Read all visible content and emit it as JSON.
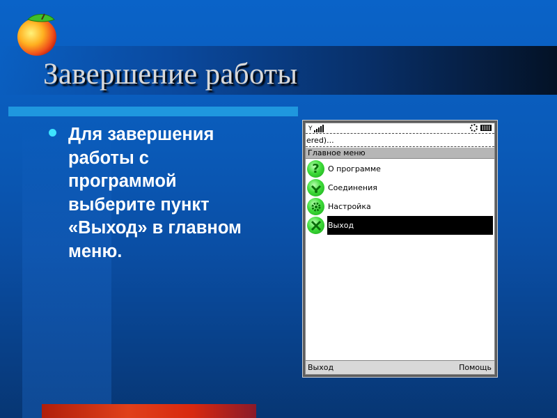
{
  "slide": {
    "title": "Завершение работы",
    "bullet": "Для завершения\nработы с\nпрограммой\nвыберите пункт\n«Выход» в главном\n меню."
  },
  "phone": {
    "connecting_text": "ered)...",
    "menu_header": "Главное меню",
    "menu_items": [
      {
        "label": "О программе",
        "icon": "help-question-icon",
        "selected": false
      },
      {
        "label": "Соединения",
        "icon": "connections-icon",
        "selected": false
      },
      {
        "label": "Настройка",
        "icon": "settings-gear-icon",
        "selected": false
      },
      {
        "label": "Выход",
        "icon": "exit-x-icon",
        "selected": true
      }
    ],
    "soft_left": "Выход",
    "soft_right": "Помощь"
  },
  "colors": {
    "background": "#0a5ab8",
    "accent_cyan": "#1f97de",
    "bullet": "#3ee4ff",
    "selection": "#000000"
  }
}
